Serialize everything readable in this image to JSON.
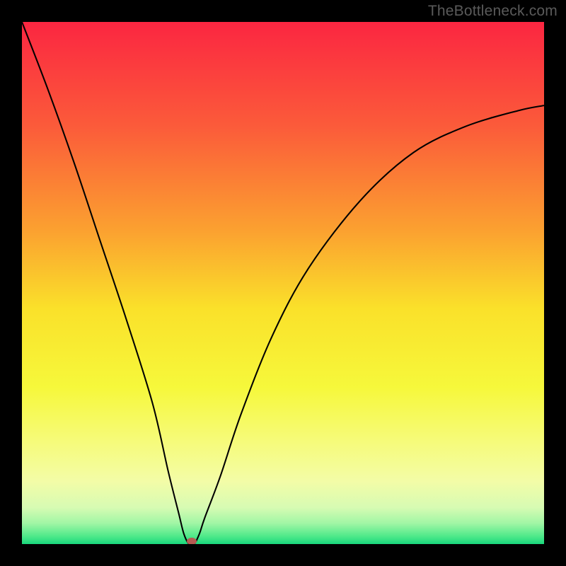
{
  "watermark": "TheBottleneck.com",
  "marker": {
    "color": "#b55a52"
  },
  "chart_data": {
    "type": "line",
    "title": "",
    "xlabel": "",
    "ylabel": "",
    "xlim": [
      0,
      100
    ],
    "ylim": [
      0,
      100
    ],
    "series": [
      {
        "name": "bottleneck-curve",
        "x": [
          0,
          5,
          10,
          15,
          20,
          25,
          28,
          30,
          31,
          32,
          33,
          34,
          35,
          38,
          42,
          48,
          55,
          65,
          75,
          85,
          95,
          100
        ],
        "y": [
          100,
          87,
          73,
          58,
          43,
          27,
          14,
          6,
          2,
          0,
          0,
          2,
          5,
          13,
          25,
          40,
          53,
          66,
          75,
          80,
          83,
          84
        ]
      }
    ],
    "marker_point": {
      "x": 32.5,
      "y": 0.5
    },
    "gradient_stops": [
      {
        "offset": 0.0,
        "color": "#fb2641"
      },
      {
        "offset": 0.2,
        "color": "#fb5b3a"
      },
      {
        "offset": 0.4,
        "color": "#fba130"
      },
      {
        "offset": 0.55,
        "color": "#fae12a"
      },
      {
        "offset": 0.7,
        "color": "#f6f83b"
      },
      {
        "offset": 0.8,
        "color": "#f6fb78"
      },
      {
        "offset": 0.88,
        "color": "#f3fca7"
      },
      {
        "offset": 0.93,
        "color": "#d7fbb3"
      },
      {
        "offset": 0.96,
        "color": "#a1f6a5"
      },
      {
        "offset": 0.985,
        "color": "#4fe98a"
      },
      {
        "offset": 1.0,
        "color": "#19d77c"
      }
    ]
  }
}
